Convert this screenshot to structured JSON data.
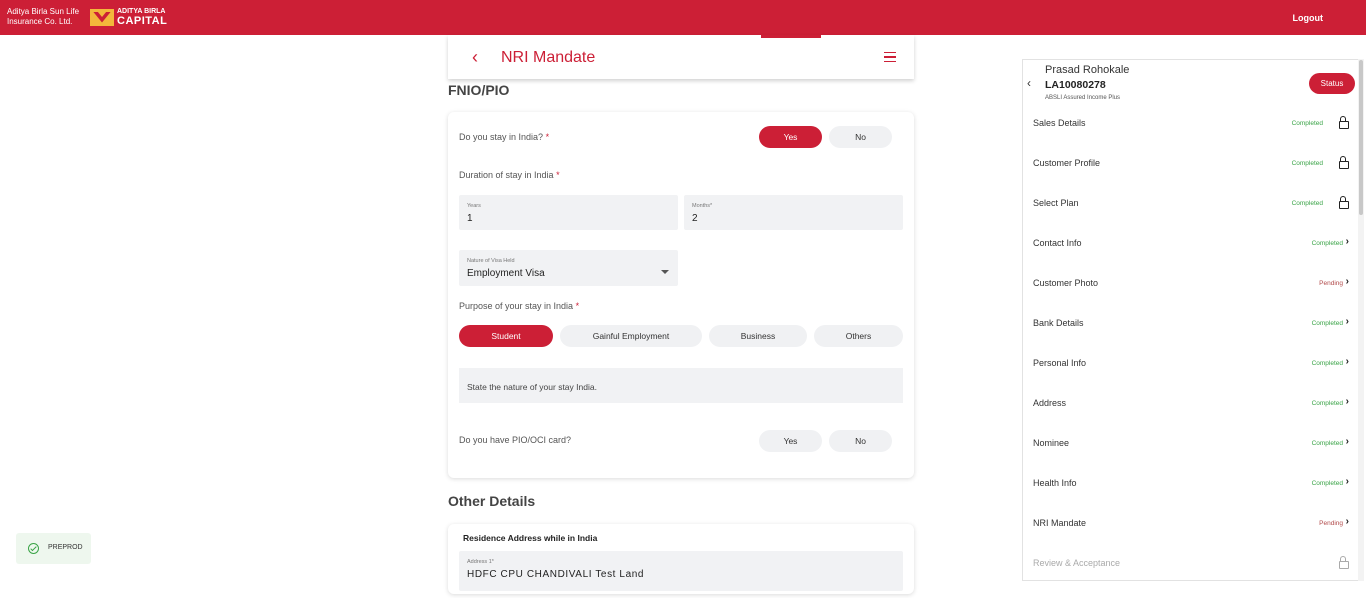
{
  "topbar": {
    "brand_left": "Aditya Birla Sun Life Insurance Co. Ltd.",
    "brand_right_line1": "ADITYA BIRLA",
    "brand_right_line2": "CAPITAL",
    "logout": "Logout"
  },
  "header": {
    "title": "NRI Mandate"
  },
  "fnio": {
    "section_title": "FNIO/PIO",
    "stay_question": "Do you stay in India?",
    "stay_options": [
      "Yes",
      "No"
    ],
    "stay_selected": "Yes",
    "duration_label": "Duration of stay in India",
    "years_label": "Years",
    "years_value": "1",
    "months_label": "Months*",
    "months_value": "2",
    "visa_label": "Nature of Visa Held",
    "visa_value": "Employment Visa",
    "purpose_label": "Purpose of your stay in India",
    "purpose_options": [
      "Student",
      "Gainful Employment",
      "Business",
      "Others"
    ],
    "purpose_selected": "Student",
    "state_placeholder": "State the nature of your stay India.",
    "pio_question": "Do you have PIO/OCI card?",
    "pio_options": [
      "Yes",
      "No"
    ],
    "required_mark": "*"
  },
  "other": {
    "section_title": "Other Details",
    "residence_title": "Residence Address while in India",
    "address1_label": "Address 1*",
    "address1_value": "HDFC CPU CHANDIVALI Test Land"
  },
  "panel": {
    "name": "Prasad Rohokale",
    "id": "LA10080278",
    "plan": "ABSLI Assured Income Plus",
    "status_button": "Status",
    "items": [
      {
        "label": "Sales Details",
        "status": "Completed",
        "icon": "lock-icon"
      },
      {
        "label": "Customer Profile",
        "status": "Completed",
        "icon": "lock-icon"
      },
      {
        "label": "Select Plan",
        "status": "Completed",
        "icon": "lock-icon"
      },
      {
        "label": "Contact Info",
        "status": "Completed",
        "icon": "chevron-right-icon"
      },
      {
        "label": "Customer Photo",
        "status": "Pending",
        "icon": "chevron-right-icon"
      },
      {
        "label": "Bank Details",
        "status": "Completed",
        "icon": "chevron-right-icon"
      },
      {
        "label": "Personal Info",
        "status": "Completed",
        "icon": "chevron-right-icon"
      },
      {
        "label": "Address",
        "status": "Completed",
        "icon": "chevron-right-icon"
      },
      {
        "label": "Nominee",
        "status": "Completed",
        "icon": "chevron-right-icon"
      },
      {
        "label": "Health Info",
        "status": "Completed",
        "icon": "chevron-right-icon"
      },
      {
        "label": "NRI Mandate",
        "status": "Pending",
        "icon": "chevron-right-icon"
      },
      {
        "label": "Review & Acceptance",
        "status": "",
        "icon": "lock-icon"
      }
    ]
  },
  "env_badge": "PREPROD",
  "colors": {
    "brand_red": "#cc1f36",
    "completed_green": "#3aa447",
    "pending_red": "#b14a4a"
  }
}
